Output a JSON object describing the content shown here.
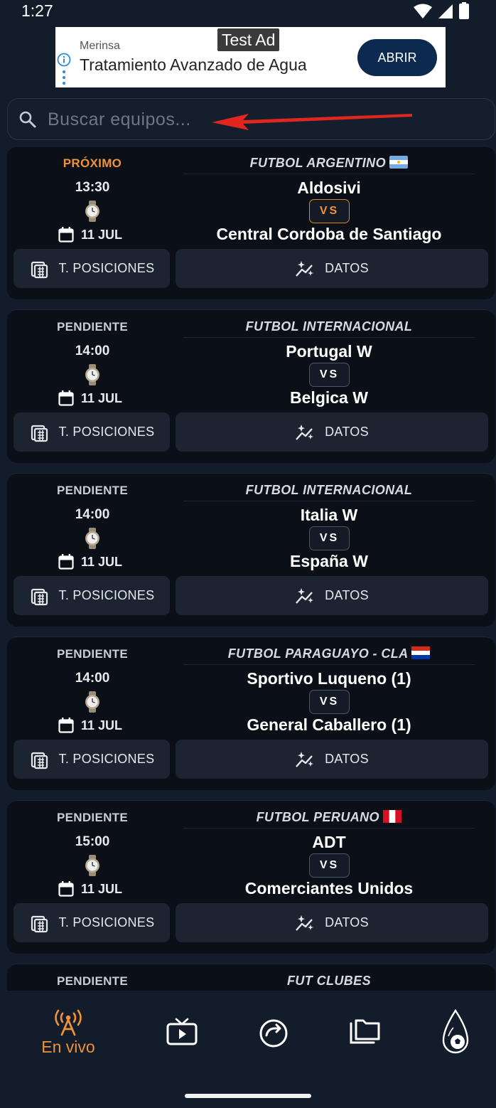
{
  "status_bar": {
    "time": "1:27"
  },
  "ad": {
    "badge": "Test Ad",
    "brand": "Merinsa",
    "title": "Tratamiento Avanzado de Agua",
    "button": "ABRIR"
  },
  "search": {
    "placeholder": "Buscar equipos..."
  },
  "matches": [
    {
      "status": "PRÓXIMO",
      "time": "13:30",
      "date": "11 JUL",
      "league": "FUTBOL ARGENTINO",
      "flag": "argentina",
      "home": "Aldosivi",
      "vs": "VS",
      "away": "Central Cordoba de Santiago",
      "positions_label": "T. POSICIONES",
      "data_label": "DATOS"
    },
    {
      "status": "PENDIENTE",
      "time": "14:00",
      "date": "11 JUL",
      "league": "FUTBOL INTERNACIONAL",
      "flag": "",
      "home": "Portugal W",
      "vs": "VS",
      "away": "Belgica W",
      "positions_label": "T. POSICIONES",
      "data_label": "DATOS"
    },
    {
      "status": "PENDIENTE",
      "time": "14:00",
      "date": "11 JUL",
      "league": "FUTBOL INTERNACIONAL",
      "flag": "",
      "home": "Italia W",
      "vs": "VS",
      "away": "España W",
      "positions_label": "T. POSICIONES",
      "data_label": "DATOS"
    },
    {
      "status": "PENDIENTE",
      "time": "14:00",
      "date": "11 JUL",
      "league": "FUTBOL PARAGUAYO - CLA",
      "flag": "paraguay",
      "home": "Sportivo Luqueno (1)",
      "vs": "VS",
      "away": "General Caballero (1)",
      "positions_label": "T. POSICIONES",
      "data_label": "DATOS"
    },
    {
      "status": "PENDIENTE",
      "time": "15:00",
      "date": "11 JUL",
      "league": "FUTBOL PERUANO",
      "flag": "peru",
      "home": "ADT",
      "vs": "VS",
      "away": "Comerciantes Unidos",
      "positions_label": "T. POSICIONES",
      "data_label": "DATOS"
    },
    {
      "status": "PENDIENTE",
      "time": "",
      "date": "",
      "league": "FUT CLUBES",
      "flag": "",
      "home": "",
      "vs": "",
      "away": "",
      "positions_label": "",
      "data_label": ""
    }
  ],
  "bottom_nav": {
    "items": [
      {
        "icon": "live-broadcast-icon",
        "label": "En vivo",
        "active": true
      },
      {
        "icon": "tv-play-icon",
        "label": "",
        "active": false
      },
      {
        "icon": "refresh-circle-icon",
        "label": "",
        "active": false
      },
      {
        "icon": "folders-icon",
        "label": "",
        "active": false
      },
      {
        "icon": "ball-drop-icon",
        "label": "",
        "active": false
      }
    ]
  },
  "colors": {
    "accent": "#f0923a",
    "background": "#131c2b",
    "card": "#0b0f17",
    "button": "#1c2331"
  }
}
